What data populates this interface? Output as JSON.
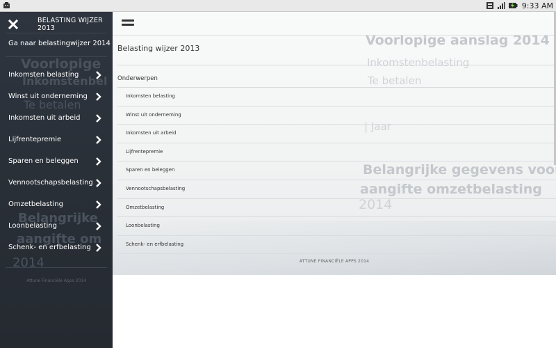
{
  "status_bar": {
    "time": "9:33 AM",
    "icons": [
      "android-notification-icon",
      "usb-debug-icon",
      "signal-icon",
      "battery-icon"
    ]
  },
  "drawer": {
    "title": "BELASTING WIJZER 2013",
    "goto_label": "Ga naar belastingwijzer 2014",
    "items": [
      {
        "label": "Inkomsten belasting"
      },
      {
        "label": "Winst uit onderneming"
      },
      {
        "label": "Inkomsten uit arbeid"
      },
      {
        "label": "Lijfrentepremie"
      },
      {
        "label": "Sparen en beleggen"
      },
      {
        "label": "Vennootschapsbelasting"
      },
      {
        "label": "Omzetbelasting"
      },
      {
        "label": "Loonbelasting"
      },
      {
        "label": "Schenk- en erfbelasting"
      }
    ],
    "footer": "Attune Financiële Apps 2014",
    "background_text": [
      "Voorlopige",
      "Inkomstenbel",
      "Te betalen",
      "Belangrijke",
      "aangifte om",
      "2014"
    ]
  },
  "main": {
    "heading": "Belasting wijzer 2013",
    "section_label": "Onderwerpen",
    "topics": [
      {
        "label": "Inkomsten belasting"
      },
      {
        "label": "Winst uit onderneming"
      },
      {
        "label": "Inkomsten uit arbeid"
      },
      {
        "label": "Lijfrentepremie"
      },
      {
        "label": "Sparen en beleggen"
      },
      {
        "label": "Vennootschapsbelasting"
      },
      {
        "label": "Omzetbelasting"
      },
      {
        "label": "Loonbelasting"
      },
      {
        "label": "Schenk- en erfbelasting"
      }
    ],
    "footer": "ATTUNE FINANCIËLE APPS 2014",
    "background_text": {
      "line1": "Voorlopige aanslag 2014",
      "line2": "Inkomstenbelasting",
      "line3": "Te betalen",
      "line4": "| Jaar",
      "line5": "Belangrijke gegevens voor",
      "line6": "aangifte omzetbelasting",
      "line7": "2014"
    }
  },
  "colors": {
    "drawer_bg": "#2a3038",
    "drawer_text": "#ffffff",
    "main_text": "#333333",
    "divider": "#d9dcdf"
  }
}
